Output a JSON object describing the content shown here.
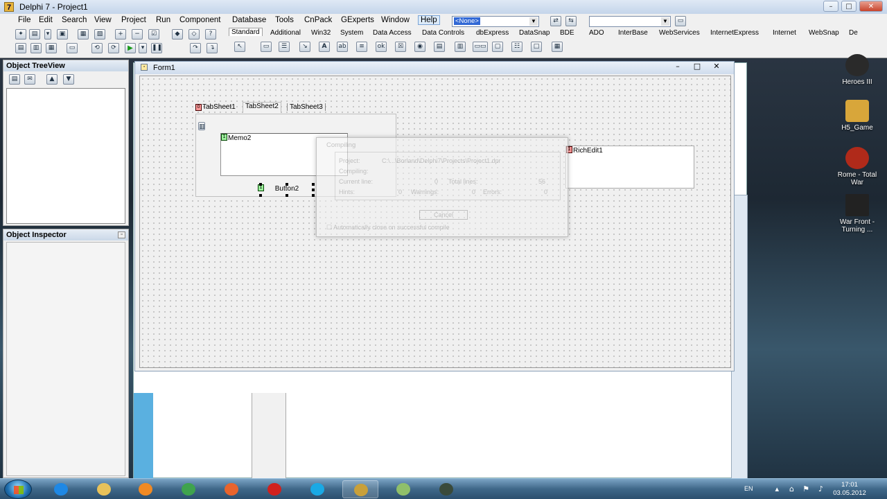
{
  "ide": {
    "title": "Delphi 7 - Project1",
    "menu": [
      "File",
      "Edit",
      "Search",
      "View",
      "Project",
      "Run",
      "Component",
      "Database",
      "Tools",
      "CnPack",
      "GExperts",
      "Window",
      "Help"
    ],
    "combo_value": "<None>",
    "palette_tabs": [
      "Standard",
      "Additional",
      "Win32",
      "System",
      "Data Access",
      "Data Controls",
      "dbExpress",
      "DataSnap",
      "BDE",
      "ADO",
      "InterBase",
      "WebServices",
      "InternetExpress",
      "Internet",
      "WebSnap",
      "De"
    ]
  },
  "treeview": {
    "title": "Object TreeView"
  },
  "inspector": {
    "title": "Object Inspector"
  },
  "form": {
    "title": "Form1",
    "tabs": [
      "TabSheet1",
      "TabSheet2",
      "TabSheet3"
    ],
    "tab1_label": "TabSheet1",
    "memo_label": "Memo2",
    "button_label": "Button2",
    "richedit_label": "RichEdit1",
    "tags": [
      "0",
      "1",
      "1"
    ]
  },
  "compile_dialog": {
    "title": "Compiling",
    "project_label": "Project:",
    "project_value": "C:\\...\\Borland\\Delphi7\\Projects\\Project1.dpr",
    "compiling_label": "Compiling:",
    "current_line_label": "Current line:",
    "current_line_value": "0",
    "total_lines_label": "Total lines:",
    "total_lines_value": "56",
    "hints_label": "Hints:",
    "hints_value": "0",
    "warnings_label": "Warnings:",
    "warnings_value": "0",
    "errors_label": "Errors:",
    "errors_value": "0",
    "cancel_label": "Cancel",
    "auto_close_label": "Automatically close on successful compile"
  },
  "desktop_icons": [
    {
      "label": "Heroes III",
      "color": "#2a2a2a"
    },
    {
      "label": "H5_Game",
      "color": "#d8a63a"
    },
    {
      "label": "Rome - Total War",
      "color": "#b02a1a"
    },
    {
      "label": "War Front - Turning ...",
      "color": "#222222"
    }
  ],
  "taskbar": {
    "apps": [
      {
        "name": "ie-icon",
        "color": "#1e88e5"
      },
      {
        "name": "explorer-icon",
        "color": "#e8c25a"
      },
      {
        "name": "media-player-icon",
        "color": "#f08a24"
      },
      {
        "name": "chrome-icon",
        "color": "#3fa34d"
      },
      {
        "name": "firefox-icon",
        "color": "#e8642c"
      },
      {
        "name": "opera-icon",
        "color": "#d0211e"
      },
      {
        "name": "skype-icon",
        "color": "#19a9e5"
      },
      {
        "name": "delphi-icon",
        "color": "#c9a03a"
      },
      {
        "name": "folder-icon",
        "color": "#8fbf6a"
      },
      {
        "name": "game-icon",
        "color": "#3a4a3a"
      }
    ],
    "language": "EN",
    "time": "17:01",
    "date": "03.05.2012"
  }
}
